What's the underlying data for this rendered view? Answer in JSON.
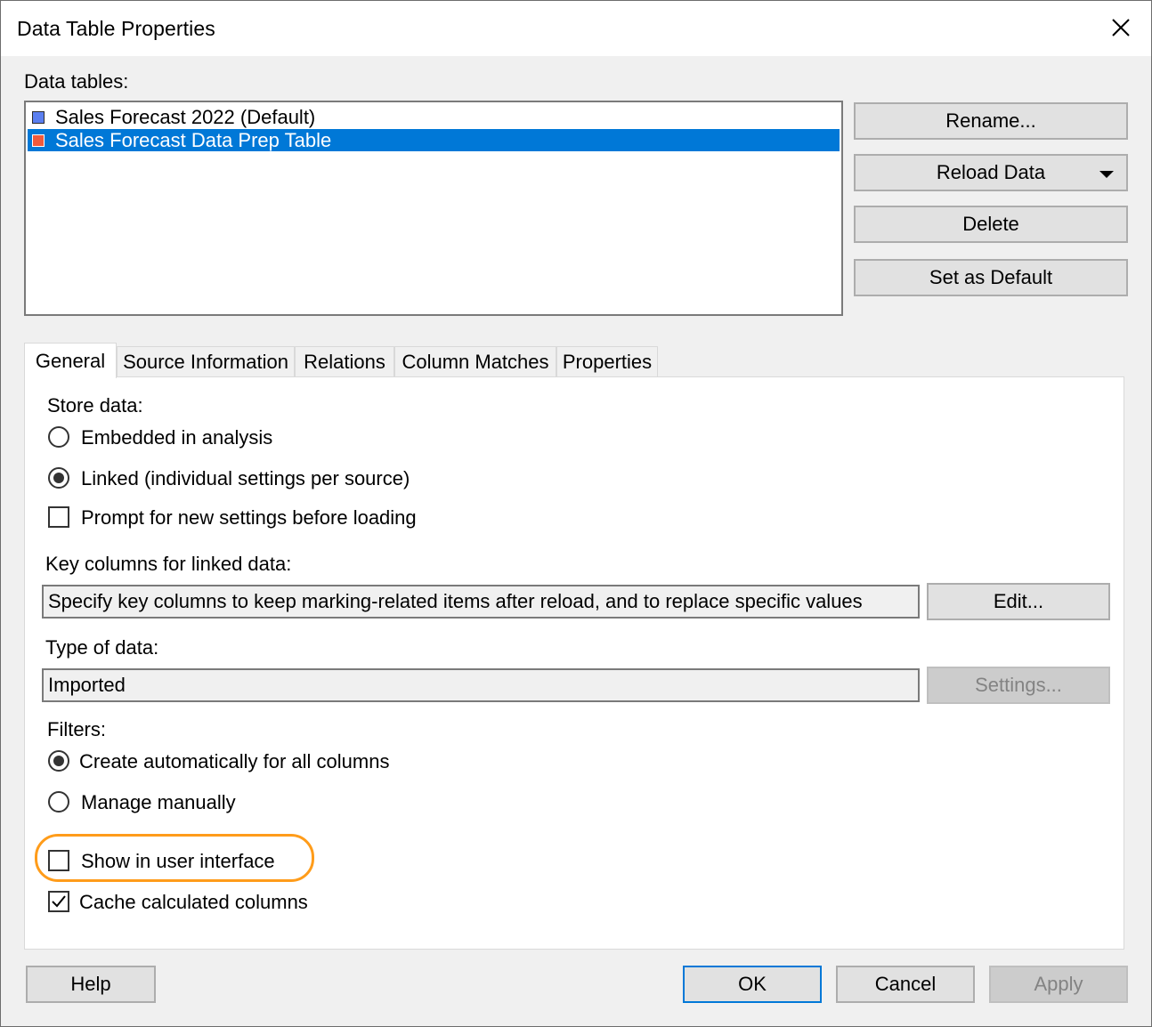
{
  "window": {
    "title": "Data Table Properties"
  },
  "data_tables": {
    "label": "Data tables:",
    "items": [
      {
        "label": "Sales Forecast 2022 (Default)",
        "color": "#5b7ff0",
        "selected": false
      },
      {
        "label": "Sales Forecast Data Prep Table",
        "color": "#f05a3c",
        "selected": true
      }
    ]
  },
  "side_buttons": {
    "rename": "Rename...",
    "reload": "Reload Data",
    "delete": "Delete",
    "set_default": "Set as Default"
  },
  "tabs": [
    "General",
    "Source Information",
    "Relations",
    "Column Matches",
    "Properties"
  ],
  "general": {
    "store_data_label": "Store data:",
    "embedded": "Embedded in analysis",
    "linked": "Linked (individual settings per source)",
    "prompt": "Prompt for new settings before loading",
    "key_columns_label": "Key columns for linked data:",
    "key_columns_value": "Specify key columns to keep marking-related items after reload, and to replace specific values",
    "edit_button": "Edit...",
    "type_label": "Type of data:",
    "type_value": "Imported",
    "settings_button": "Settings...",
    "filters_label": "Filters:",
    "filters_auto": "Create automatically for all columns",
    "filters_manual": "Manage manually",
    "show_ui": "Show in user interface",
    "cache": "Cache calculated columns"
  },
  "footer": {
    "help": "Help",
    "ok": "OK",
    "cancel": "Cancel",
    "apply": "Apply"
  },
  "colors": {
    "selection": "#0078d7",
    "highlight_ring": "#ff9c1a"
  }
}
